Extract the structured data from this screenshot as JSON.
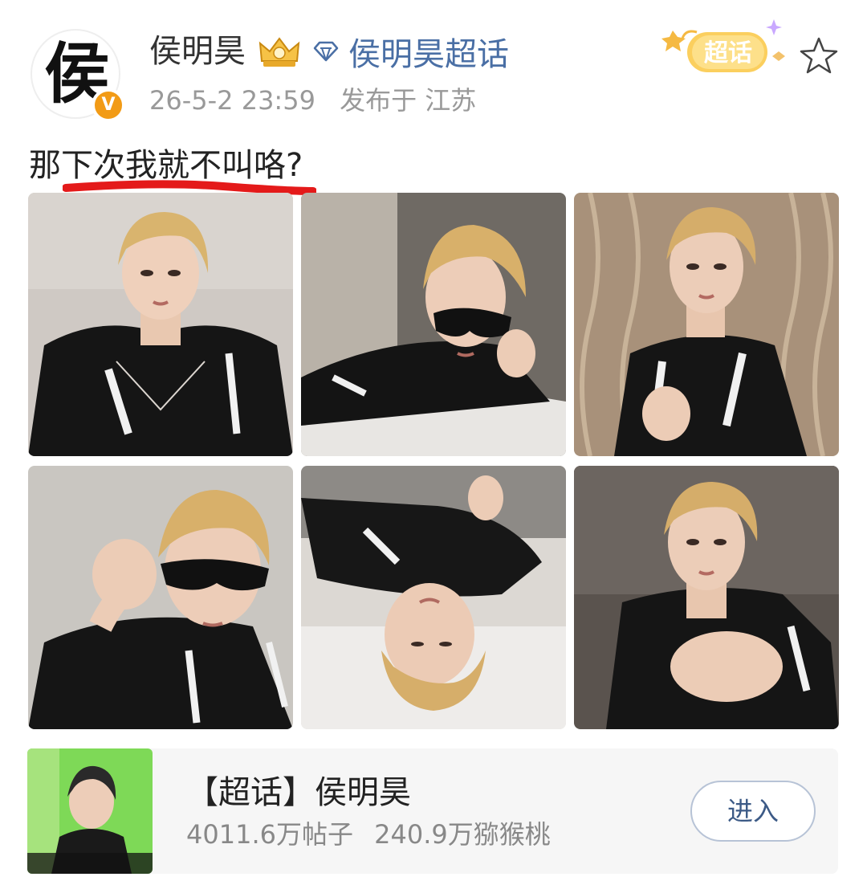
{
  "author": {
    "avatar_char": "侯",
    "verified_mark": "V",
    "name": "侯明昊",
    "supertopic_link": "侯明昊超话"
  },
  "meta": {
    "datetime": "26-5-2 23:59",
    "location": "发布于 江苏"
  },
  "badge": {
    "label": "超话"
  },
  "post": {
    "text": "那下次我就不叫咯?"
  },
  "photos": [
    {
      "description": "photo-1"
    },
    {
      "description": "photo-2"
    },
    {
      "description": "photo-3"
    },
    {
      "description": "photo-4"
    },
    {
      "description": "photo-5"
    },
    {
      "description": "photo-6"
    }
  ],
  "topic_card": {
    "title": "【超话】侯明昊",
    "posts": "4011.6万帖子",
    "fans": "240.9万猕猴桃",
    "enter_label": "进入"
  },
  "colors": {
    "link": "#4a6fa5",
    "badge": "#f5b942",
    "underline": "#e41a1a"
  }
}
